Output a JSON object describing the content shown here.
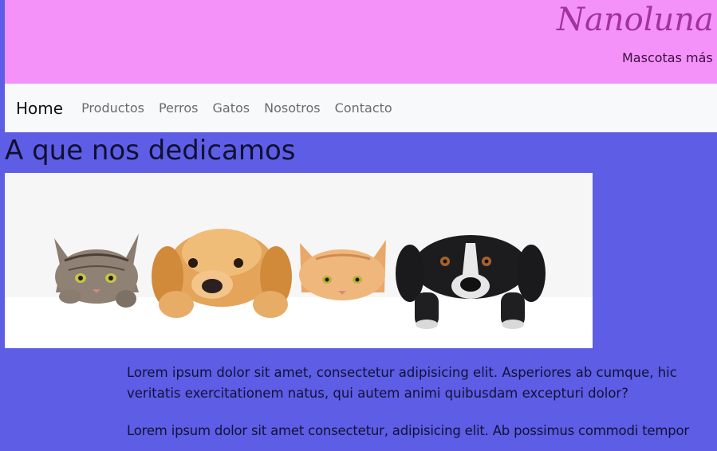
{
  "header": {
    "title": "Nanoluna P",
    "subtitle": "Mascotas más"
  },
  "nav": {
    "brand": "Home",
    "links": [
      "Productos",
      "Perros",
      "Gatos",
      "Nosotros",
      "Contacto"
    ]
  },
  "main": {
    "heading": "A que nos dedicamos",
    "paragraph_1_line_1": "Lorem ipsum dolor sit amet, consectetur adipisicing elit. Asperiores ab cumque, hic",
    "paragraph_1_line_2": "veritatis exercitationem natus, qui autem animi quibusdam excepturi dolor?",
    "paragraph_2_line_1": "Lorem ipsum dolor sit amet consectetur, adipisicing elit. Ab possimus commodi tempor"
  },
  "colors": {
    "background": "#5d5de5",
    "header": "#f592f9",
    "title": "#a2329e",
    "navbar": "#f8f9fa"
  }
}
